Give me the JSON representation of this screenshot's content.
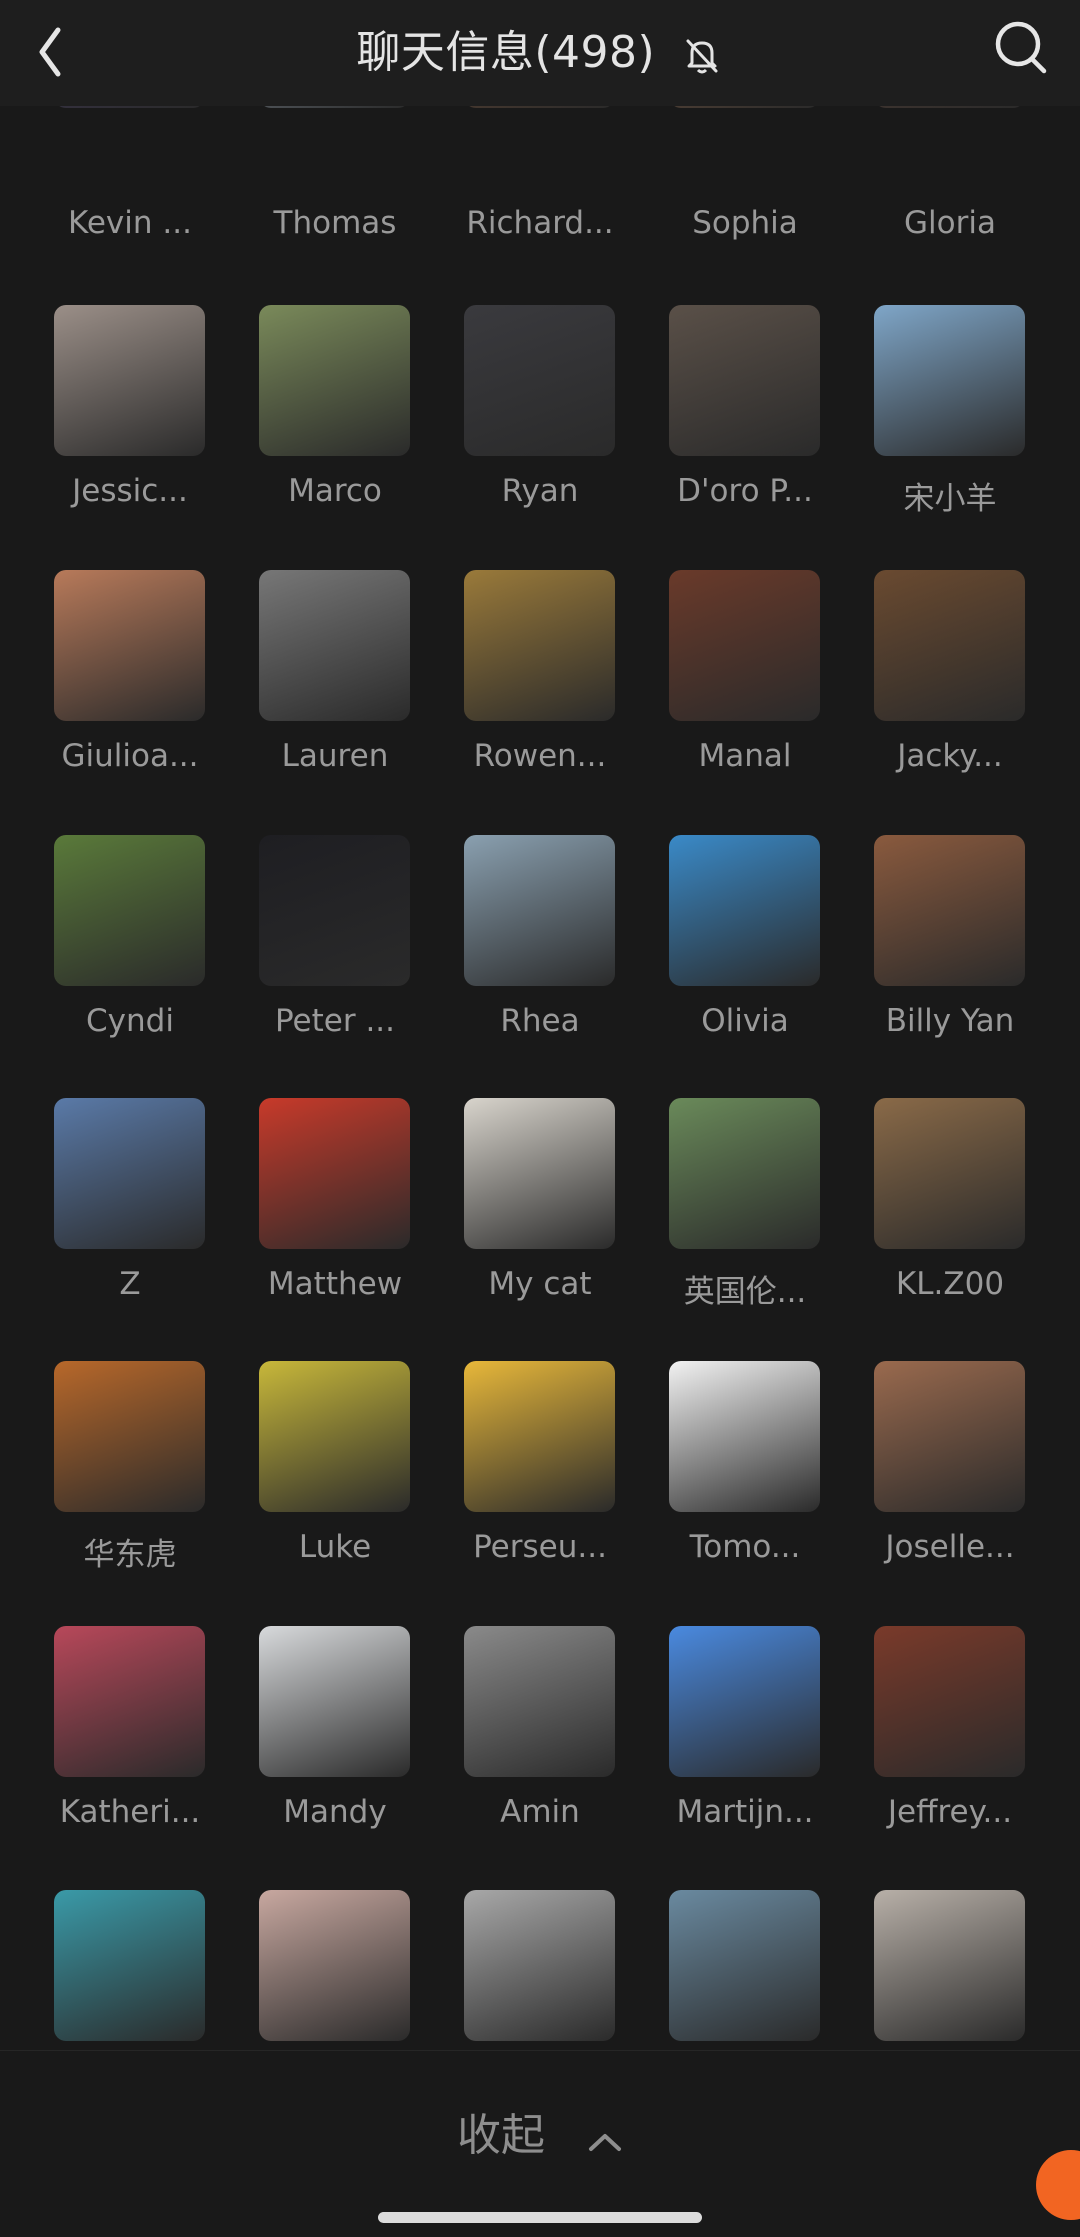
{
  "header": {
    "title": "聊天信息(498)",
    "back_icon": "chevron-left-icon",
    "mute_icon": "bell-off-icon",
    "search_icon": "search-icon"
  },
  "members": [
    {
      "name": "Kevin ...",
      "color": "#4b3f6e"
    },
    {
      "name": "Thomas",
      "color": "#a8b8c8"
    },
    {
      "name": "Richard...",
      "color": "#8a5a3a"
    },
    {
      "name": "Sophia",
      "color": "#9a6b4a"
    },
    {
      "name": "Gloria",
      "color": "#6a4a3a"
    },
    {
      "name": "Jessic...",
      "color": "#9b8f88"
    },
    {
      "name": "Marco",
      "color": "#7a8a5a"
    },
    {
      "name": "Ryan",
      "color": "#3a3a3e"
    },
    {
      "name": "D'oro P...",
      "color": "#5a5048"
    },
    {
      "name": "宋小羊",
      "color": "#7fa6c8"
    },
    {
      "name": "Giulioa...",
      "color": "#b87a5a"
    },
    {
      "name": "Lauren",
      "color": "#777777"
    },
    {
      "name": "Rowen...",
      "color": "#9a7a3a"
    },
    {
      "name": "Manal",
      "color": "#6a3a2a"
    },
    {
      "name": "Jacky...",
      "color": "#6a4a30"
    },
    {
      "name": "Cyndi",
      "color": "#5a7a3a"
    },
    {
      "name": "Peter ...",
      "color": "#1e1e22"
    },
    {
      "name": "Rhea",
      "color": "#8aa0b0"
    },
    {
      "name": "Olivia",
      "color": "#3a8ac8"
    },
    {
      "name": "Billy Yan",
      "color": "#8a5a3e"
    },
    {
      "name": "Z",
      "color": "#5a7aa8"
    },
    {
      "name": "Matthew",
      "color": "#c83a2a"
    },
    {
      "name": "My cat",
      "color": "#d8d4cc"
    },
    {
      "name": "英国伦...",
      "color": "#6a8a5a"
    },
    {
      "name": "KL.Z00",
      "color": "#8a6a48"
    },
    {
      "name": "华东虎",
      "color": "#b8682a"
    },
    {
      "name": "Luke",
      "color": "#c8b83a"
    },
    {
      "name": "Perseu...",
      "color": "#e8b83a"
    },
    {
      "name": "Tomo...",
      "color": "#f2f2f2"
    },
    {
      "name": "Joselle...",
      "color": "#9a6a4e"
    },
    {
      "name": "Katheri...",
      "color": "#b8485a"
    },
    {
      "name": "Mandy",
      "color": "#d8dadc"
    },
    {
      "name": "Amin",
      "color": "#8a8a8a"
    },
    {
      "name": "Martijn...",
      "color": "#4a8ae0"
    },
    {
      "name": "Jeffrey...",
      "color": "#7a3a2a"
    },
    {
      "name": "",
      "color": "#3a9aa8"
    },
    {
      "name": "",
      "color": "#c8a8a0"
    },
    {
      "name": "",
      "color": "#a8a8a8"
    },
    {
      "name": "",
      "color": "#6a8aa0"
    },
    {
      "name": "",
      "color": "#b8b0a8"
    }
  ],
  "footer": {
    "collapse_label": "收起",
    "collapse_icon": "chevron-up-icon"
  }
}
